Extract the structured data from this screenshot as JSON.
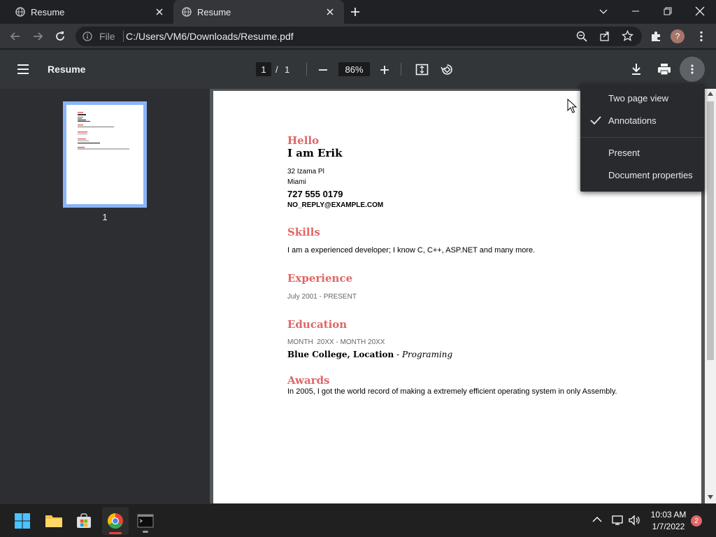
{
  "tabs": [
    {
      "title": "Resume"
    },
    {
      "title": "Resume"
    }
  ],
  "omnibox": {
    "scheme_label": "File",
    "url": "C:/Users/VM6/Downloads/Resume.pdf"
  },
  "pdf_toolbar": {
    "title": "Resume",
    "current_page": "1",
    "page_separator": "/",
    "total_pages": "1",
    "zoom": "86%"
  },
  "sidebar": {
    "thumbnail_label": "1"
  },
  "menu": {
    "items": [
      {
        "label": "Two page view",
        "checked": false
      },
      {
        "label": "Annotations",
        "checked": true
      },
      {
        "label": "Present",
        "checked": false
      },
      {
        "label": "Document properties",
        "checked": false
      }
    ]
  },
  "resume": {
    "greeting": "Hello",
    "name": "I am Erik",
    "address_line1": "32 Izama Pl",
    "address_line2": "Miami",
    "phone": "727 555 0179",
    "email": "NO_REPLY@EXAMPLE.COM",
    "skills_heading": "Skills",
    "skills_text": "I am a experienced developer; I know C, C++, ASP.NET and many more.",
    "experience_heading": "Experience",
    "experience_dates": "July 2001 - PRESENT",
    "education_heading": "Education",
    "education_dates": "MONTH  20XX - MONTH 20XX",
    "education_school": "Blue College, Location",
    "education_dash": " - ",
    "education_field": "Programing",
    "awards_heading": "Awards",
    "awards_text": "In 2005, I got the world record of making a extremely efficient operating system in only Assembly."
  },
  "taskbar": {
    "time": "10:03 AM",
    "date": "1/7/2022",
    "notification_count": "2"
  },
  "colors": {
    "accent": "#8ab4f8",
    "resume_heading": "#e06666",
    "chrome_red": "#ea4335"
  }
}
